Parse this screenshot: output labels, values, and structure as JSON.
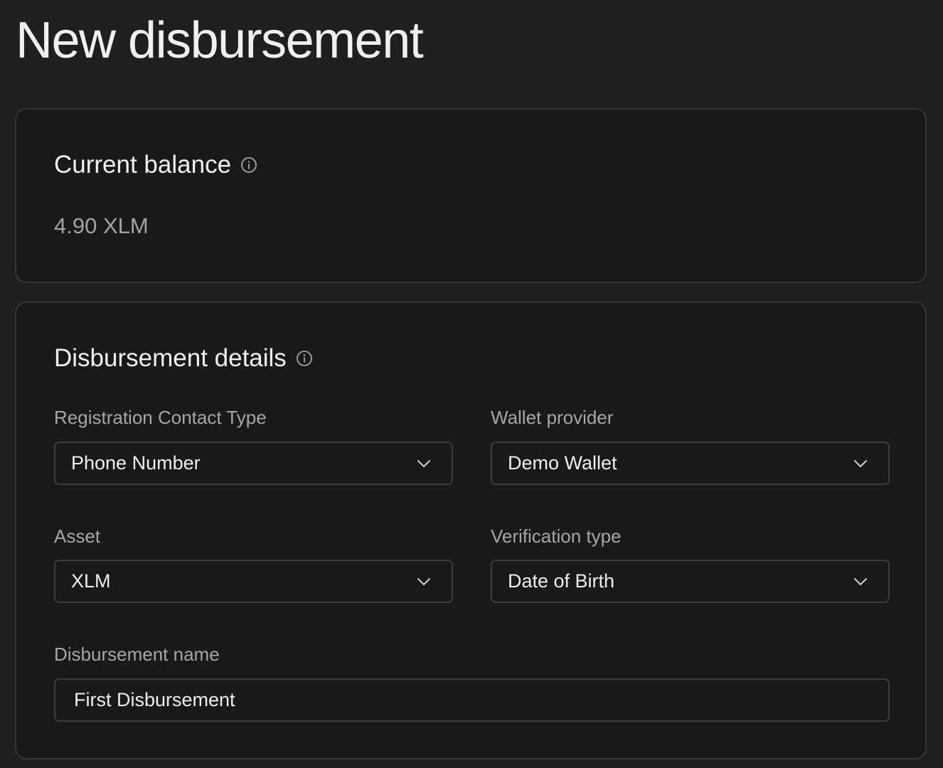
{
  "page": {
    "title": "New disbursement"
  },
  "balance_card": {
    "heading": "Current balance",
    "info_icon": "info-icon",
    "value": "4.90 XLM"
  },
  "details_card": {
    "heading": "Disbursement details",
    "info_icon": "info-icon",
    "fields": {
      "registration_contact_type": {
        "label": "Registration Contact Type",
        "value": "Phone Number",
        "icon": "chevron-down-icon"
      },
      "wallet_provider": {
        "label": "Wallet provider",
        "value": "Demo Wallet",
        "icon": "chevron-down-icon"
      },
      "asset": {
        "label": "Asset",
        "value": "XLM",
        "icon": "chevron-down-icon"
      },
      "verification_type": {
        "label": "Verification type",
        "value": "Date of Birth",
        "icon": "chevron-down-icon"
      },
      "disbursement_name": {
        "label": "Disbursement name",
        "value": "First Disbursement"
      }
    }
  },
  "colors": {
    "background": "#1f1f1f",
    "card_background": "#191919",
    "card_border": "#353535",
    "text_primary": "#f0f0f0",
    "text_secondary": "#a6a6a6"
  }
}
